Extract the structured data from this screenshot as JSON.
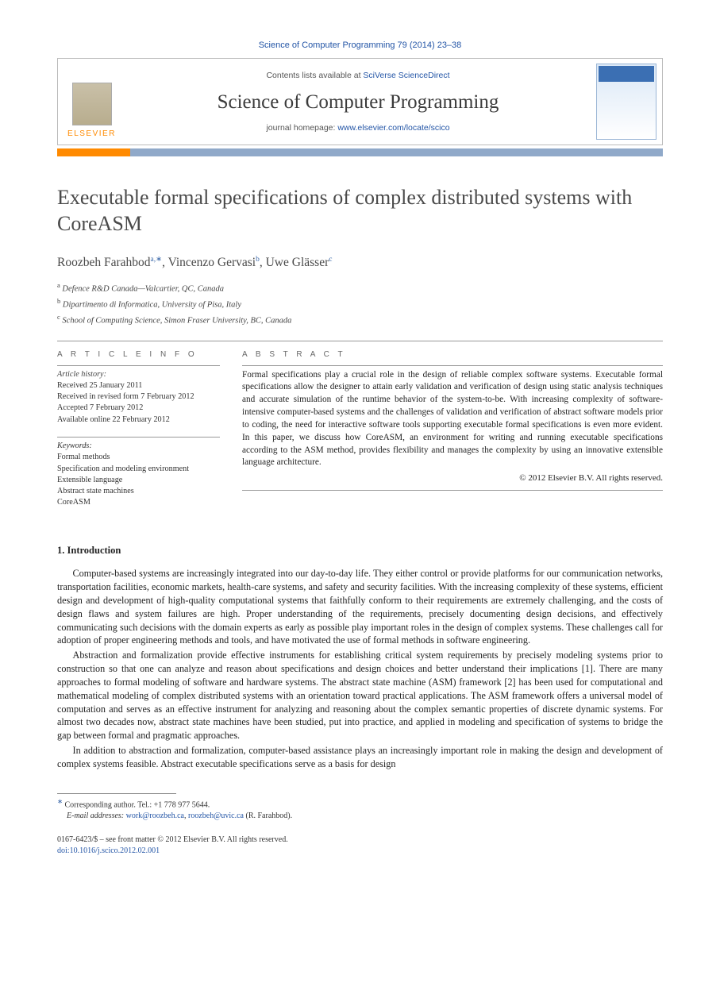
{
  "header": {
    "citation": "Science of Computer Programming 79 (2014) 23–38",
    "contents_prefix": "Contents lists available at ",
    "contents_link": "SciVerse ScienceDirect",
    "journal": "Science of Computer Programming",
    "homepage_prefix": "journal homepage: ",
    "homepage_link": "www.elsevier.com/locate/scico",
    "publisher": "ELSEVIER"
  },
  "title": "Executable formal specifications of complex distributed systems with CoreASM",
  "authors": {
    "a1_name": "Roozbeh Farahbod",
    "a1_aff": "a,",
    "a1_star": "∗",
    "a2_name": "Vincenzo Gervasi",
    "a2_aff": "b",
    "a3_name": "Uwe Glässer",
    "a3_aff": "c"
  },
  "affiliations": {
    "a": "Defence R&D Canada—Valcartier, QC, Canada",
    "b": "Dipartimento di Informatica, University of Pisa, Italy",
    "c": "School of Computing Science, Simon Fraser University, BC, Canada"
  },
  "article_info": {
    "label": "A R T I C L E   I N F O",
    "history_label": "Article history:",
    "received": "Received 25 January 2011",
    "revised": "Received in revised form 7 February 2012",
    "accepted": "Accepted 7 February 2012",
    "online": "Available online 22 February 2012",
    "keywords_label": "Keywords:",
    "kw1": "Formal methods",
    "kw2": "Specification and modeling environment",
    "kw3": "Extensible language",
    "kw4": "Abstract state machines",
    "kw5": "CoreASM"
  },
  "abstract": {
    "label": "A B S T R A C T",
    "text": "Formal specifications play a crucial role in the design of reliable complex software systems. Executable formal specifications allow the designer to attain early validation and verification of design using static analysis techniques and accurate simulation of the runtime behavior of the system-to-be. With increasing complexity of software-intensive computer-based systems and the challenges of validation and verification of abstract software models prior to coding, the need for interactive software tools supporting executable formal specifications is even more evident. In this paper, we discuss how CoreASM, an environment for writing and running executable specifications according to the ASM method, provides flexibility and manages the complexity by using an innovative extensible language architecture.",
    "copyright": "© 2012 Elsevier B.V. All rights reserved."
  },
  "section1": {
    "heading": "1. Introduction",
    "p1": "Computer-based systems are increasingly integrated into our day-to-day life. They either control or provide platforms for our communication networks, transportation facilities, economic markets, health-care systems, and safety and security facilities. With the increasing complexity of these systems, efficient design and development of high-quality computational systems that faithfully conform to their requirements are extremely challenging, and the costs of design flaws and system failures are high. Proper understanding of the requirements, precisely documenting design decisions, and effectively communicating such decisions with the domain experts as early as possible play important roles in the design of complex systems. These challenges call for adoption of proper engineering methods and tools, and have motivated the use of formal methods in software engineering.",
    "p2": "Abstraction and formalization provide effective instruments for establishing critical system requirements by precisely modeling systems prior to construction so that one can analyze and reason about specifications and design choices and better understand their implications [1]. There are many approaches to formal modeling of software and hardware systems. The abstract state machine (ASM) framework [2] has been used for computational and mathematical modeling of complex distributed systems with an orientation toward practical applications. The ASM framework offers a universal model of computation and serves as an effective instrument for analyzing and reasoning about the complex semantic properties of discrete dynamic systems. For almost two decades now, abstract state machines have been studied, put into practice, and applied in modeling and specification of systems to bridge the gap between formal and pragmatic approaches.",
    "p3": "In addition to abstraction and formalization, computer-based assistance plays an increasingly important role in making the design and development of complex systems feasible. Abstract executable specifications serve as a basis for design"
  },
  "footnotes": {
    "corr": "Corresponding author. Tel.: +1 778 977 5644.",
    "email_label": "E-mail addresses:",
    "email1": "work@roozbeh.ca",
    "email2": "roozbeh@uvic.ca",
    "email_suffix": " (R. Farahbod)."
  },
  "bottom": {
    "issn_line": "0167-6423/$ – see front matter © 2012 Elsevier B.V. All rights reserved.",
    "doi_label": "doi:",
    "doi": "10.1016/j.scico.2012.02.001"
  }
}
